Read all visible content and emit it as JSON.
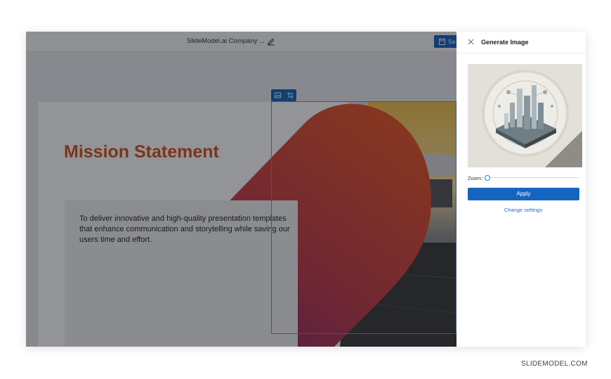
{
  "topbar": {
    "doc_title": "SlideModel.ai Company ...",
    "save_label": "Sa"
  },
  "slide": {
    "title": "Mission Statement",
    "body": "To deliver innovative and high-quality presentation templates that enhance communication and storytelling while saving our users time and effort."
  },
  "panel": {
    "title": "Generate Image",
    "zoom_label": "Zoom:",
    "zoom_level": 0,
    "apply_label": "Apply",
    "change_settings_label": "Change settings"
  },
  "watermark": "SLIDEMODEL.COM",
  "icons": {
    "edit": "pencil-icon",
    "save": "floppy-disk-icon",
    "close": "close-icon",
    "image_toolbar": [
      "image-icon",
      "crop-icon"
    ]
  },
  "colors": {
    "accent": "#1565c0",
    "title_orange": "#d5531d",
    "link": "#1e6ec7"
  }
}
